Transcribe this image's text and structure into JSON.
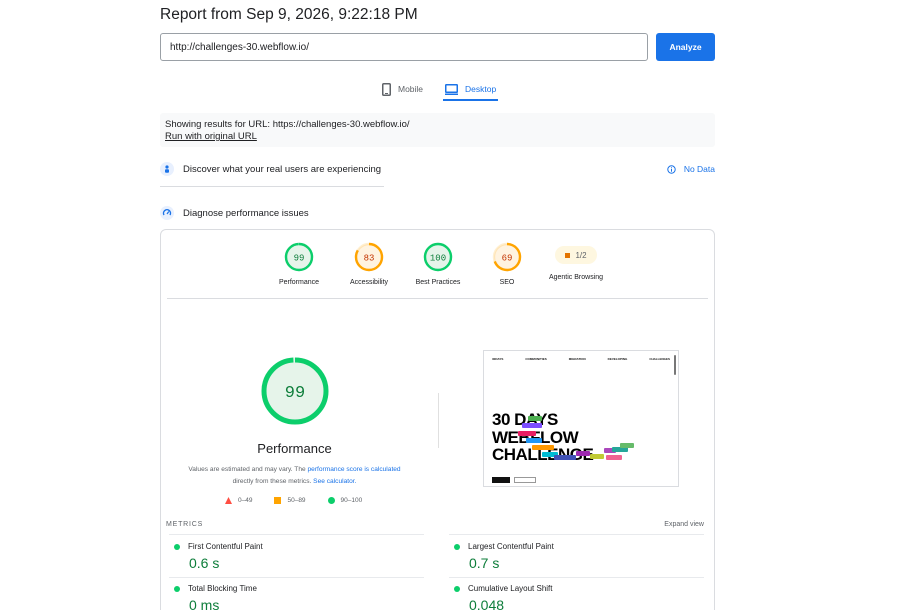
{
  "header": {
    "title": "Report from Sep 9, 2026, 9:22:18 PM"
  },
  "url_bar": {
    "value": "http://challenges-30.webflow.io/",
    "analyze_label": "Analyze"
  },
  "device_tabs": [
    {
      "label": "Mobile",
      "active": false,
      "icon": "phone-icon"
    },
    {
      "label": "Desktop",
      "active": true,
      "icon": "desktop-icon"
    }
  ],
  "results": {
    "showing_text": "Showing results for URL: https://challenges-30.webflow.io/",
    "run_link": "Run with original URL"
  },
  "real_users": {
    "title": "Discover what your real users are experiencing",
    "status": "No Data",
    "icon": "people-icon",
    "status_icon": "info-icon"
  },
  "diagnose": {
    "title": "Diagnose performance issues",
    "icon": "gauge-icon"
  },
  "scores": [
    {
      "label": "Performance",
      "score": "99",
      "value": 99,
      "color": "#0cce6b",
      "text_color": "#0d7d3a",
      "bg": "#e6f4ea"
    },
    {
      "label": "Accessibility",
      "score": "83",
      "value": 83,
      "color": "#ffa400",
      "text_color": "#c33300",
      "bg": "#fff3e0"
    },
    {
      "label": "Best Practices",
      "score": "100",
      "value": 100,
      "color": "#0cce6b",
      "text_color": "#0d7d3a",
      "bg": "#e6f4ea"
    },
    {
      "label": "SEO",
      "score": "69",
      "value": 69,
      "color": "#ffa400",
      "text_color": "#c33300",
      "bg": "#fff3e0"
    }
  ],
  "agentic": {
    "label": "Agentic Browsing",
    "value": "1/2"
  },
  "performance": {
    "score": "99",
    "value": 99,
    "label": "Performance",
    "note_prefix": "Values are estimated and may vary. The ",
    "note_link1": "performance score is calculated",
    "note_mid": "directly from these metrics. ",
    "note_link2": "See calculator.",
    "legend": [
      {
        "range": "0–49",
        "shape": "triangle",
        "color": "#ff4e42"
      },
      {
        "range": "50–89",
        "shape": "square",
        "color": "#ffa400"
      },
      {
        "range": "90–100",
        "shape": "circle",
        "color": "#0cce6b"
      }
    ]
  },
  "screenshot": {
    "logo": "30DAYS",
    "nav": [
      "COMMUNITIES",
      "MIGRATION",
      "DEVELOPING",
      "CHALLENGES"
    ],
    "headline": [
      "30 DAYS",
      "WEBFLOW",
      "CHALLENGE"
    ]
  },
  "metrics": {
    "heading": "METRICS",
    "expand_label": "Expand view",
    "items": [
      {
        "name": "First Contentful Paint",
        "value": "0.6 s"
      },
      {
        "name": "Largest Contentful Paint",
        "value": "0.7 s"
      },
      {
        "name": "Total Blocking Time",
        "value": "0 ms"
      },
      {
        "name": "Cumulative Layout Shift",
        "value": "0.048"
      }
    ]
  }
}
